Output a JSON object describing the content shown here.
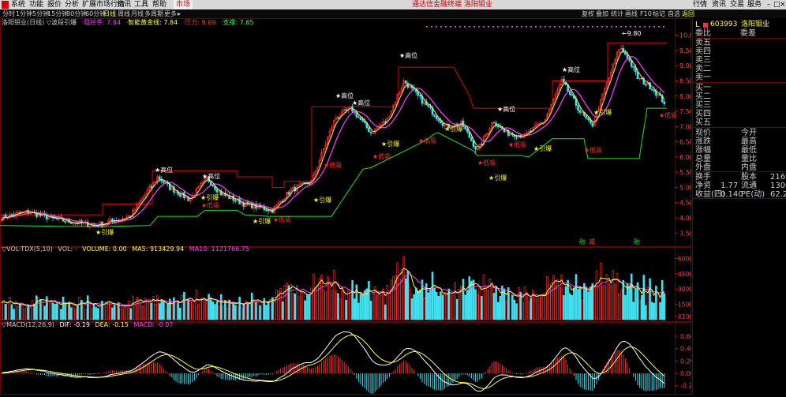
{
  "menubar": {
    "items": [
      "系统",
      "功能",
      "报价",
      "分析",
      "扩展市场行情",
      "资讯",
      "工具",
      "帮助"
    ],
    "market": "市场",
    "center_title": "通达信金融终端 洛阳钼业",
    "right_items": [
      "行情",
      "资讯",
      "交易",
      "服务"
    ]
  },
  "toolbar": {
    "periods": [
      "分时",
      "1分钟",
      "5分钟",
      "15分钟",
      "30分钟",
      "60分钟",
      "日线",
      "周线",
      "月线",
      "多周期",
      "更多"
    ],
    "active_period": "日线",
    "right_buttons": [
      "复权",
      "叠加",
      "统计",
      "画线",
      "F10",
      "标记",
      "自选",
      "返回"
    ]
  },
  "main_chart": {
    "title": "洛阳钼业(日线)",
    "indicator_name": "▽波段引爆",
    "legend": [
      {
        "text": "·阻拦手: 7.94",
        "color": "#ff40ff"
      },
      {
        "text": "·智能黄金线: 7.84",
        "color": "#ffff40"
      },
      {
        "text": "·压力: 9.69",
        "color": "#ff3030"
      },
      {
        "text": "·支撑: 7.65",
        "color": "#30ff30"
      }
    ],
    "y_ticks": [
      "10.00",
      "9.50",
      "9.00",
      "8.50",
      "8.00",
      "7.50",
      "7.00",
      "6.50",
      "6.00",
      "5.50",
      "5.00",
      "4.50",
      "4.00",
      "3.50"
    ],
    "annotations": [
      {
        "text": "★高位",
        "color": "#ffffff"
      },
      {
        "text": "★高位",
        "color": "#ffffff"
      },
      {
        "text": "★高位",
        "color": "#ffffff"
      },
      {
        "text": "★高位",
        "color": "#ffffff"
      },
      {
        "text": "★高位",
        "color": "#ffffff"
      },
      {
        "text": "★高位",
        "color": "#ffffff"
      },
      {
        "text": "★高位",
        "color": "#ffffff"
      },
      {
        "text": "★引爆",
        "color": "#ffff00"
      },
      {
        "text": "★引爆",
        "color": "#ffff00"
      },
      {
        "text": "★引爆",
        "color": "#ffff00"
      },
      {
        "text": "★引爆",
        "color": "#ffff00"
      },
      {
        "text": "★引爆",
        "color": "#ffff00"
      },
      {
        "text": "★引爆",
        "color": "#ffff00"
      },
      {
        "text": "★引爆",
        "color": "#ffff00"
      },
      {
        "text": "★引爆",
        "color": "#ffff00"
      },
      {
        "text": "★引爆",
        "color": "#ffff00"
      },
      {
        "text": "★低吸",
        "color": "#ff3030"
      },
      {
        "text": "★低吸",
        "color": "#ff3030"
      },
      {
        "text": "★低吸",
        "color": "#ff3030"
      },
      {
        "text": "★低吸",
        "color": "#ff3030"
      },
      {
        "text": "★低吸",
        "color": "#ff3030"
      },
      {
        "text": "★低吸",
        "color": "#ff3030"
      },
      {
        "text": "★低吸",
        "color": "#ff3030"
      },
      {
        "text": "★低吸",
        "color": "#ff3030"
      },
      {
        "text": "★低吸",
        "color": "#ff3030"
      }
    ],
    "max_label": "9.80",
    "bottom_tags": [
      "融",
      "减",
      "融"
    ]
  },
  "volume_panel": {
    "title": "▽VOL-TDX(5,10)",
    "legend": [
      {
        "text": "VOL: -",
        "color": "#cccccc"
      },
      {
        "text": "VOLUME: 0.00",
        "color": "#ffff40"
      },
      {
        "text": "MA5: 913429.94",
        "color": "#ffff40"
      },
      {
        "text": "MA10: 1121766.75",
        "color": "#ff40ff"
      }
    ],
    "y_ticks": [
      "60000",
      "45000",
      "30000",
      "15000",
      "X100"
    ]
  },
  "macd_panel": {
    "title": "▽MACD(12,26,9)",
    "legend": [
      {
        "text": "DIF: -0.19",
        "color": "#ffffff"
      },
      {
        "text": "DEA: -0.15",
        "color": "#ffff40"
      },
      {
        "text": "MACD: -0.07",
        "color": "#ff40ff"
      }
    ],
    "y_ticks": [
      "0.60",
      "0.40",
      "0.20",
      "0.00",
      "-0.20"
    ]
  },
  "quote_panel": {
    "code": "603993",
    "name": "洛阳钼业",
    "header_left": "委比",
    "header_right": "委差",
    "sell_levels": [
      "卖五",
      "卖四",
      "卖三",
      "卖二",
      "卖一"
    ],
    "buy_levels": [
      "买一",
      "买二",
      "买三",
      "买四",
      "买五"
    ],
    "stats": [
      {
        "l1": "现价",
        "l2": "今开"
      },
      {
        "l1": "涨跌",
        "l2": "最高"
      },
      {
        "l1": "涨幅",
        "l2": "最低"
      },
      {
        "l1": "总量",
        "l2": "量比"
      },
      {
        "l1": "外盘",
        "l2": "内盘"
      }
    ],
    "fundamentals": [
      {
        "l1": "换手",
        "v1": "",
        "l2": "股本",
        "v2": "216亿"
      },
      {
        "l1": "净资",
        "v1": "1.77",
        "l2": "流通",
        "v2": "130亿"
      },
      {
        "l1": "收益(四)",
        "v1": "0.140",
        "l2": "PE(动)",
        "v2": "62.2"
      }
    ]
  },
  "colors": {
    "up": "#ff3030",
    "down": "#40e0f0",
    "resistance": "#e00000",
    "support": "#20e020",
    "ma_yellow": "#ffff40",
    "ma_magenta": "#ff40ff"
  }
}
